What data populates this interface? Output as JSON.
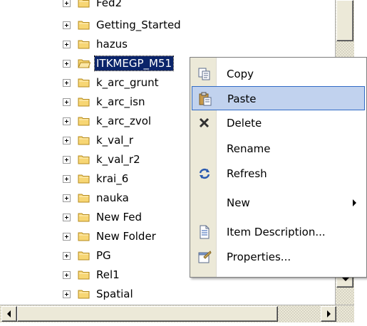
{
  "tree": {
    "items": [
      {
        "label": "Fed2",
        "selected": false
      },
      {
        "label": "Getting_Started",
        "selected": false
      },
      {
        "label": "hazus",
        "selected": false
      },
      {
        "label": "ITKMEGP_M51",
        "selected": true
      },
      {
        "label": "k_arc_grunt",
        "selected": false
      },
      {
        "label": "k_arc_isn",
        "selected": false
      },
      {
        "label": "k_arc_zvol",
        "selected": false
      },
      {
        "label": "k_val_r",
        "selected": false
      },
      {
        "label": "k_val_r2",
        "selected": false
      },
      {
        "label": "krai_6",
        "selected": false
      },
      {
        "label": "nauka",
        "selected": false
      },
      {
        "label": "New Fed",
        "selected": false
      },
      {
        "label": "New Folder",
        "selected": false
      },
      {
        "label": "PG",
        "selected": false
      },
      {
        "label": "Rel1",
        "selected": false
      },
      {
        "label": "Spatial",
        "selected": false
      }
    ]
  },
  "context_menu": {
    "items": [
      {
        "label": "Copy",
        "icon": "copy-icon",
        "hover": false,
        "submenu": false
      },
      {
        "label": "Paste",
        "icon": "paste-icon",
        "hover": true,
        "submenu": false
      },
      {
        "label": "Delete",
        "icon": "delete-icon",
        "hover": false,
        "submenu": false
      },
      {
        "label": "Rename",
        "icon": "",
        "hover": false,
        "submenu": false
      },
      {
        "label": "Refresh",
        "icon": "refresh-icon",
        "hover": false,
        "submenu": false
      },
      {
        "label": "New",
        "icon": "",
        "hover": false,
        "submenu": true
      },
      {
        "label": "Item Description...",
        "icon": "item-description-icon",
        "hover": false,
        "submenu": false
      },
      {
        "label": "Properties...",
        "icon": "properties-icon",
        "hover": false,
        "submenu": false
      }
    ]
  },
  "colors": {
    "selection_bg": "#0a246a",
    "menu_hover_bg": "#c1d2ee",
    "menu_hover_border": "#316ac5",
    "folder_fill": "#f7d674",
    "folder_outline": "#b48a1c"
  }
}
